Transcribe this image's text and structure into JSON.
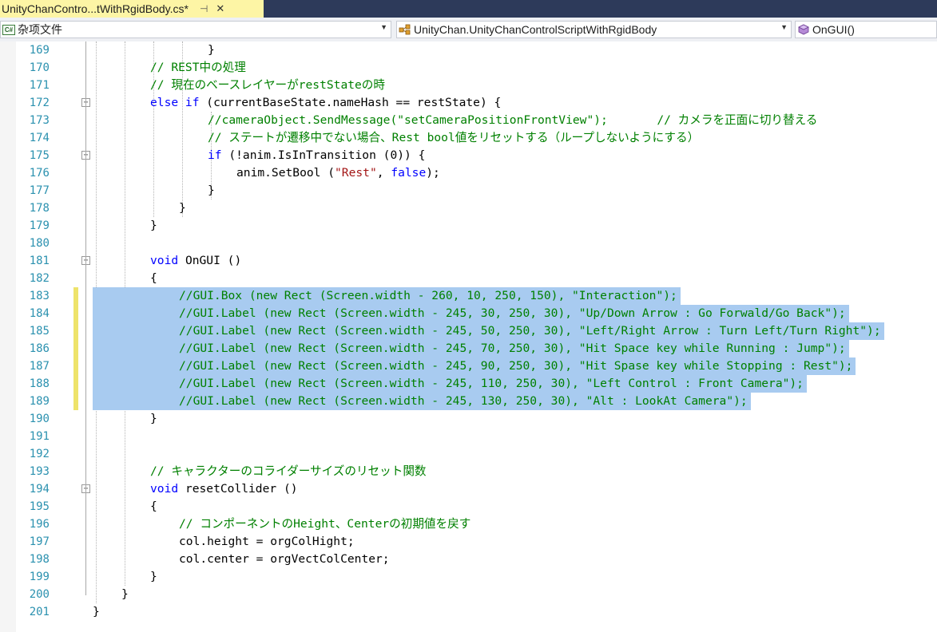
{
  "tab": {
    "title": "UnityChanContro...tWithRgidBody.cs*",
    "pin": "⊣",
    "close": "✕"
  },
  "nav": {
    "project_icon": "cs-project-icon",
    "project": "杂项文件",
    "class_icon": "class-icon",
    "class": "UnityChan.UnityChanControlScriptWithRgidBody",
    "member_icon": "method-icon",
    "member": "OnGUI()"
  },
  "colors": {
    "keyword": "#0000ff",
    "comment": "#008000",
    "string": "#a31515",
    "linenum": "#2b91af",
    "selection": "#a8cbf0",
    "change_bar": "#eee36a"
  },
  "lines": [
    {
      "n": "169",
      "indent": 4,
      "parts": [
        [
          "t",
          "}"
        ]
      ]
    },
    {
      "n": "170",
      "indent": 2,
      "parts": [
        [
          "c",
          "// REST中の処理"
        ]
      ]
    },
    {
      "n": "171",
      "indent": 2,
      "parts": [
        [
          "c",
          "// 現在のベースレイヤーがrestStateの時"
        ]
      ]
    },
    {
      "n": "172",
      "indent": 2,
      "fold": true,
      "parts": [
        [
          "k",
          "else if"
        ],
        [
          "t",
          " (currentBaseState.nameHash == restState) {"
        ]
      ]
    },
    {
      "n": "173",
      "indent": 4,
      "parts": [
        [
          "c",
          "//cameraObject.SendMessage(\"setCameraPositionFrontView\");       // カメラを正面に切り替える"
        ]
      ]
    },
    {
      "n": "174",
      "indent": 4,
      "parts": [
        [
          "c",
          "// ステートが遷移中でない場合、Rest bool値をリセットする（ループしないようにする）"
        ]
      ]
    },
    {
      "n": "175",
      "indent": 4,
      "fold": true,
      "parts": [
        [
          "k",
          "if"
        ],
        [
          "t",
          " (!anim.IsInTransition (0)) {"
        ]
      ]
    },
    {
      "n": "176",
      "indent": 5,
      "parts": [
        [
          "t",
          "anim.SetBool ("
        ],
        [
          "s",
          "\"Rest\""
        ],
        [
          "t",
          ", "
        ],
        [
          "k",
          "false"
        ],
        [
          "t",
          ");"
        ]
      ]
    },
    {
      "n": "177",
      "indent": 4,
      "parts": [
        [
          "t",
          "}"
        ]
      ]
    },
    {
      "n": "178",
      "indent": 3,
      "parts": [
        [
          "t",
          "}"
        ]
      ]
    },
    {
      "n": "179",
      "indent": 2,
      "parts": [
        [
          "t",
          "}"
        ]
      ]
    },
    {
      "n": "180",
      "indent": 0,
      "parts": []
    },
    {
      "n": "181",
      "indent": 2,
      "fold": true,
      "parts": [
        [
          "k",
          "void"
        ],
        [
          "t",
          " OnGUI ()"
        ]
      ]
    },
    {
      "n": "182",
      "indent": 2,
      "parts": [
        [
          "t",
          "{"
        ]
      ]
    },
    {
      "n": "183",
      "indent": 3,
      "sel": true,
      "changed": true,
      "parts": [
        [
          "c",
          "//GUI.Box (new Rect (Screen.width - 260, 10, 250, 150), \"Interaction\");"
        ]
      ]
    },
    {
      "n": "184",
      "indent": 3,
      "sel": true,
      "changed": true,
      "parts": [
        [
          "c",
          "//GUI.Label (new Rect (Screen.width - 245, 30, 250, 30), \"Up/Down Arrow : Go Forwald/Go Back\");"
        ]
      ]
    },
    {
      "n": "185",
      "indent": 3,
      "sel": true,
      "changed": true,
      "parts": [
        [
          "c",
          "//GUI.Label (new Rect (Screen.width - 245, 50, 250, 30), \"Left/Right Arrow : Turn Left/Turn Right\");"
        ]
      ]
    },
    {
      "n": "186",
      "indent": 3,
      "sel": true,
      "changed": true,
      "parts": [
        [
          "c",
          "//GUI.Label (new Rect (Screen.width - 245, 70, 250, 30), \"Hit Space key while Running : Jump\");"
        ]
      ]
    },
    {
      "n": "187",
      "indent": 3,
      "sel": true,
      "changed": true,
      "parts": [
        [
          "c",
          "//GUI.Label (new Rect (Screen.width - 245, 90, 250, 30), \"Hit Spase key while Stopping : Rest\");"
        ]
      ]
    },
    {
      "n": "188",
      "indent": 3,
      "sel": true,
      "changed": true,
      "parts": [
        [
          "c",
          "//GUI.Label (new Rect (Screen.width - 245, 110, 250, 30), \"Left Control : Front Camera\");"
        ]
      ]
    },
    {
      "n": "189",
      "indent": 3,
      "sel": true,
      "changed": true,
      "parts": [
        [
          "c",
          "//GUI.Label (new Rect (Screen.width - 245, 130, 250, 30), \"Alt : LookAt Camera\");"
        ]
      ]
    },
    {
      "n": "190",
      "indent": 2,
      "parts": [
        [
          "t",
          "}"
        ]
      ]
    },
    {
      "n": "191",
      "indent": 0,
      "parts": []
    },
    {
      "n": "192",
      "indent": 0,
      "parts": []
    },
    {
      "n": "193",
      "indent": 2,
      "parts": [
        [
          "c",
          "// キャラクターのコライダーサイズのリセット関数"
        ]
      ]
    },
    {
      "n": "194",
      "indent": 2,
      "fold": true,
      "parts": [
        [
          "k",
          "void"
        ],
        [
          "t",
          " resetCollider ()"
        ]
      ]
    },
    {
      "n": "195",
      "indent": 2,
      "parts": [
        [
          "t",
          "{"
        ]
      ]
    },
    {
      "n": "196",
      "indent": 3,
      "parts": [
        [
          "c",
          "// コンポーネントのHeight、Centerの初期値を戻す"
        ]
      ]
    },
    {
      "n": "197",
      "indent": 3,
      "parts": [
        [
          "t",
          "col.height = orgColHight;"
        ]
      ]
    },
    {
      "n": "198",
      "indent": 3,
      "parts": [
        [
          "t",
          "col.center = orgVectColCenter;"
        ]
      ]
    },
    {
      "n": "199",
      "indent": 2,
      "parts": [
        [
          "t",
          "}"
        ]
      ]
    },
    {
      "n": "200",
      "indent": 1,
      "parts": [
        [
          "t",
          "}"
        ]
      ]
    },
    {
      "n": "201",
      "indent": 0,
      "parts": [
        [
          "t",
          "}"
        ]
      ]
    }
  ]
}
